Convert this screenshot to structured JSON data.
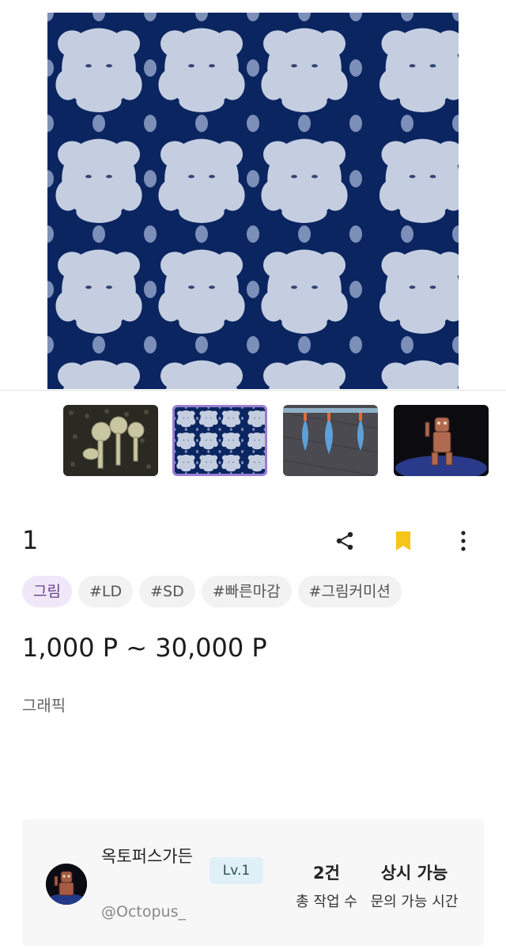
{
  "product": {
    "title": "1",
    "price": "1,000 P ~ 30,000 P",
    "subcategory": "그래픽",
    "category_tag": "그림",
    "tags": [
      "#LD",
      "#SD",
      "#빠른마감",
      "#그림커미션"
    ]
  },
  "gallery": {
    "selected_index": 1,
    "thumbnails": [
      "thumbnail-1",
      "thumbnail-2",
      "thumbnail-3",
      "thumbnail-4"
    ]
  },
  "actions": {
    "share_icon": "share-icon",
    "bookmark_icon": "bookmark-icon",
    "more_icon": "more-vertical-icon",
    "bookmark_color": "#f5c518"
  },
  "seller": {
    "name": "옥토퍼스가든",
    "handle": "@Octopus_",
    "level": "Lv.1",
    "stats": [
      {
        "value": "2건",
        "label": "총 작업 수"
      },
      {
        "value": "상시 가능",
        "label": "문의 가능 시간"
      }
    ]
  },
  "colors": {
    "accent": "#9b7dd4",
    "category_tag_bg": "#f0e8f8",
    "category_tag_text": "#6b3f8f",
    "level_badge_bg": "#dff1f7"
  }
}
